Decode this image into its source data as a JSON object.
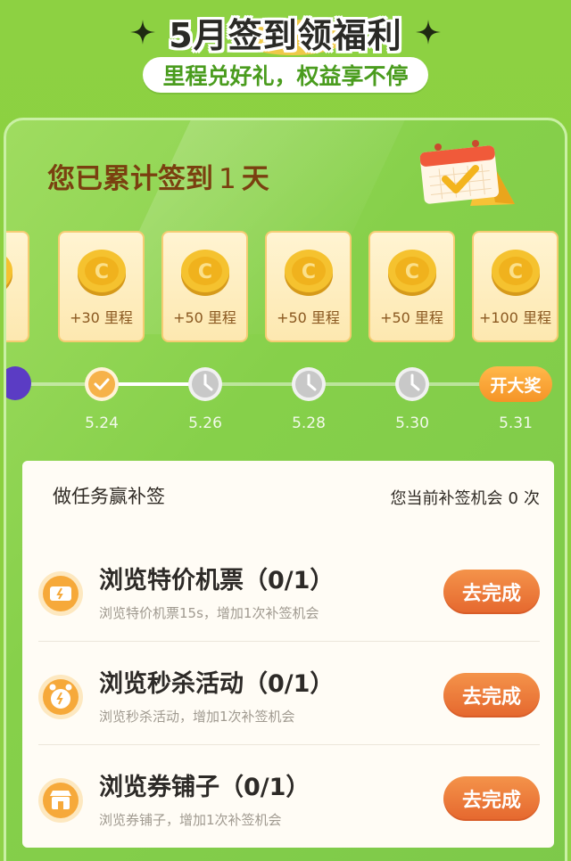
{
  "header": {
    "title": "5月签到领福利",
    "subtitle": "里程兑好礼，权益享不停"
  },
  "checkin": {
    "prefix": "您已累计签到",
    "days": "1",
    "suffix": "天"
  },
  "rewards": [
    {
      "label": "+30 里程"
    },
    {
      "label": "+50 里程"
    },
    {
      "label": "+50 里程"
    },
    {
      "label": "+50 里程"
    },
    {
      "label": "+100 里程"
    }
  ],
  "timeline": {
    "dates": [
      "5.24",
      "5.26",
      "5.28",
      "5.30",
      "5.31"
    ],
    "prize_label": "开大奖"
  },
  "tasks": {
    "title": "做任务赢补签",
    "makeup_prefix": "您当前补签机会",
    "makeup_count": "0",
    "makeup_suffix": "次",
    "items": [
      {
        "name": "浏览特价机票（0/1）",
        "desc": "浏览特价机票15s，增加1次补签机会",
        "button": "去完成",
        "icon": "ticket-icon"
      },
      {
        "name": "浏览秒杀活动（0/1）",
        "desc": "浏览秒杀活动，增加1次补签机会",
        "button": "去完成",
        "icon": "alarm-clock-icon"
      },
      {
        "name": "浏览券铺子（0/1）",
        "desc": "浏览券铺子，增加1次补签机会",
        "button": "去完成",
        "icon": "shop-icon"
      }
    ]
  },
  "colors": {
    "background": "#8dd142",
    "accent_orange": "#e5672e",
    "text_brown": "#7a4010",
    "reward_bg": "#fde8b0"
  }
}
